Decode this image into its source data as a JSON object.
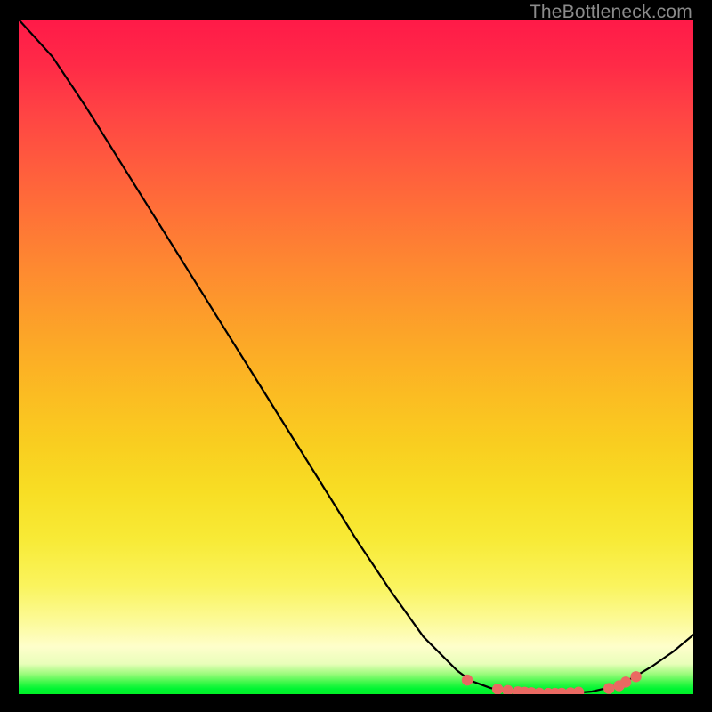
{
  "watermark": "TheBottleneck.com",
  "chart_data": {
    "type": "line",
    "title": "",
    "xlabel": "",
    "ylabel": "",
    "xlim": [
      0,
      100
    ],
    "ylim": [
      0,
      100
    ],
    "grid": false,
    "series": [
      {
        "name": "curve",
        "stroke": "#000000",
        "x": [
          0,
          5,
          10,
          15,
          20,
          25,
          30,
          35,
          40,
          45,
          50,
          55,
          60,
          65,
          67,
          70,
          73,
          76,
          79,
          82,
          85,
          88,
          91,
          94,
          97,
          100
        ],
        "y": [
          100,
          94.5,
          87,
          79,
          71,
          63,
          55,
          47,
          39,
          31,
          23,
          15.5,
          8.5,
          3.5,
          2.0,
          0.9,
          0.35,
          0.15,
          0.1,
          0.15,
          0.4,
          1.1,
          2.4,
          4.2,
          6.3,
          8.8
        ]
      },
      {
        "name": "dots",
        "stroke": "#ea6962",
        "marker": "circle",
        "x": [
          66.5,
          71.0,
          72.5,
          74.0,
          75.0,
          76.0,
          77.2,
          78.5,
          79.5,
          80.5,
          81.8,
          83.0,
          87.5,
          89.0,
          90.0,
          91.5
        ],
        "y": [
          2.1,
          0.75,
          0.55,
          0.35,
          0.28,
          0.22,
          0.15,
          0.12,
          0.12,
          0.14,
          0.2,
          0.3,
          0.85,
          1.25,
          1.8,
          2.6
        ]
      }
    ],
    "gradient_bg": {
      "direction": "vertical",
      "stops": [
        {
          "pos": 0.0,
          "color": "#ff1a48"
        },
        {
          "pos": 0.5,
          "color": "#fcab26"
        },
        {
          "pos": 0.85,
          "color": "#faf45e"
        },
        {
          "pos": 0.97,
          "color": "#9bfb7c"
        },
        {
          "pos": 1.0,
          "color": "#00f126"
        }
      ]
    }
  }
}
